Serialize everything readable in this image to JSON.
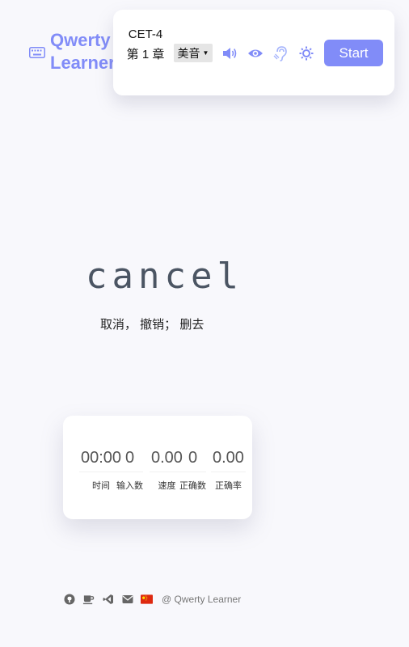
{
  "header": {
    "app_name": "Qwerty Learner"
  },
  "toolbar": {
    "dictionary_chapter": "CET-4 第 1 章",
    "accent": "美音",
    "start_label": "Start",
    "icons": [
      "keyboard-icon",
      "sound-icon",
      "eye-icon",
      "hearing-icon",
      "sun-icon"
    ]
  },
  "word": {
    "text": "cancel",
    "translation": "取消， 撤销； 删去"
  },
  "stats": {
    "time": {
      "value": "00:00",
      "label": "时间"
    },
    "inputs": {
      "value": "0",
      "label": "输入数"
    },
    "speed": {
      "value": "0.00",
      "label": "速度"
    },
    "correct": {
      "value": "0",
      "label": "正确数"
    },
    "accuracy": {
      "value": "0.00",
      "label": "正确率"
    }
  },
  "footer": {
    "copyright": "@ Qwerty Learner",
    "icons": [
      "github-icon",
      "coffee-icon",
      "vscode-icon",
      "mail-icon",
      "china-flag-icon"
    ]
  },
  "colors": {
    "accent": "#818cf8",
    "background": "#f8f8fc"
  }
}
